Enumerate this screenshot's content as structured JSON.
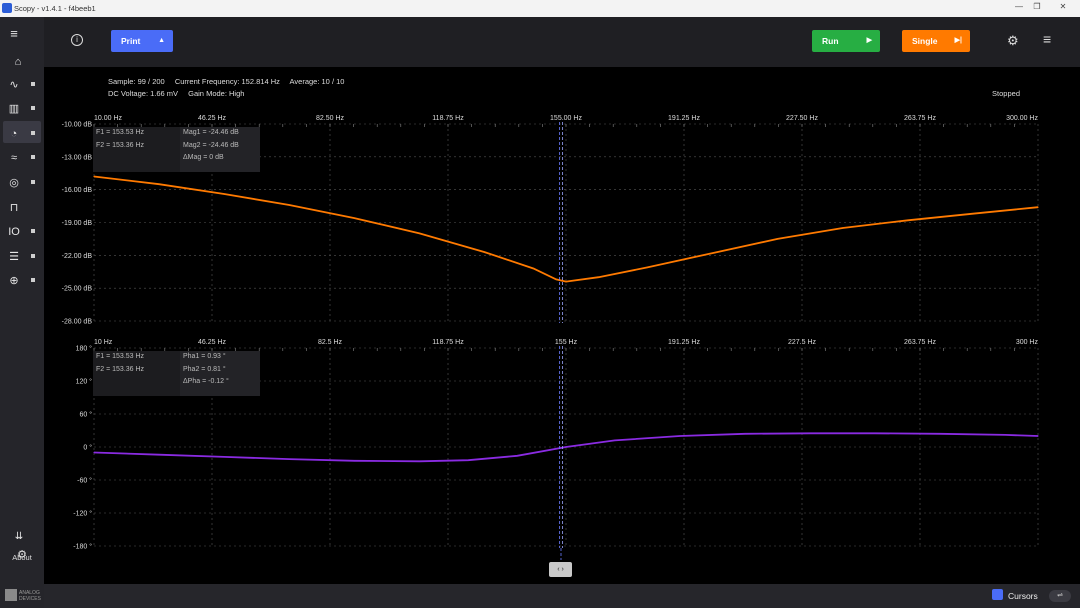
{
  "window": {
    "title": "Scopy - v1.4.1 - f4beeb1"
  },
  "toolbar": {
    "print_label": "Print",
    "run_label": "Run",
    "single_label": "Single",
    "colors": {
      "print": "#4a6cf7",
      "run": "#27ae43",
      "single": "#ff7a00"
    }
  },
  "sidebar": {
    "items": [
      {
        "icon": "home-icon"
      },
      {
        "icon": "oscilloscope-icon"
      },
      {
        "icon": "spectrum-analyzer-icon"
      },
      {
        "icon": "network-analyzer-icon"
      },
      {
        "icon": "signal-generator-icon"
      },
      {
        "icon": "voltmeter-icon"
      },
      {
        "icon": "pattern-generator-icon"
      },
      {
        "icon": "digital-io-icon"
      },
      {
        "icon": "power-supply-icon"
      },
      {
        "icon": "logic-analyzer-icon"
      }
    ],
    "about_label": "About"
  },
  "status": {
    "sample": "Sample: 99 / 200",
    "current_frequency": "Current Frequency: 152.814 Hz",
    "average": "Average: 10 / 10",
    "dc_voltage": "DC Voltage: 1.66 mV",
    "gain_mode": "Gain Mode: High",
    "state": "Stopped"
  },
  "magnitude_plot": {
    "x_ticks": [
      "10.00 Hz",
      "46.25 Hz",
      "82.50 Hz",
      "118.75 Hz",
      "155.00 Hz",
      "191.25 Hz",
      "227.50 Hz",
      "263.75 Hz",
      "300.00 Hz"
    ],
    "y_ticks": [
      "-10.00 dB",
      "-13.00 dB",
      "-16.00 dB",
      "-19.00 dB",
      "-22.00 dB",
      "-25.00 dB",
      "-28.00 dB"
    ],
    "readout": {
      "f1": "F1 =  153.53 Hz",
      "f2": "F2 =  153.36 Hz",
      "v1": "Mag1 =  -24.46 dB",
      "v2": "Mag2 =  -24.46 dB",
      "dv": "ΔMag =  0 dB"
    }
  },
  "phase_plot": {
    "x_ticks": [
      "10 Hz",
      "46.25 Hz",
      "82.5 Hz",
      "118.75 Hz",
      "155 Hz",
      "191.25 Hz",
      "227.5 Hz",
      "263.75 Hz",
      "300 Hz"
    ],
    "y_ticks": [
      "180 °",
      "120 °",
      "60 °",
      "0 °",
      "-60 °",
      "-120 °",
      "-180 °"
    ],
    "readout": {
      "f1": "F1 =  153.53 Hz",
      "f2": "F2 =  153.36 Hz",
      "v1": "Pha1 =  0.93 °",
      "v2": "Pha2 =  0.81 °",
      "dv": "ΔPha =  -0.12 °"
    }
  },
  "chart_data": [
    {
      "type": "line",
      "xlim": [
        10,
        300
      ],
      "ylim": [
        -28,
        -10
      ],
      "color": "#ff7a00",
      "cursor_x": 153.5,
      "series": [
        {
          "x": [
            10,
            30,
            50,
            70,
            90,
            110,
            130,
            145,
            152,
            155,
            165,
            180,
            200,
            220,
            240,
            260,
            280,
            300
          ],
          "y": [
            -14.8,
            -15.5,
            -16.4,
            -17.4,
            -18.6,
            -20.0,
            -21.7,
            -23.2,
            -24.2,
            -24.4,
            -24.0,
            -23.1,
            -21.8,
            -20.5,
            -19.5,
            -18.8,
            -18.2,
            -17.6
          ]
        }
      ]
    },
    {
      "type": "line",
      "xlim": [
        10,
        300
      ],
      "ylim": [
        -180,
        180
      ],
      "color": "#8a2be2",
      "cursor_x": 153.5,
      "series": [
        {
          "x": [
            10,
            30,
            50,
            70,
            90,
            110,
            125,
            140,
            155,
            170,
            190,
            210,
            230,
            250,
            270,
            290,
            300
          ],
          "y": [
            -10,
            -14,
            -18,
            -22,
            -25,
            -26,
            -24,
            -16,
            0,
            12,
            20,
            24,
            25,
            25,
            24,
            22,
            20
          ]
        }
      ]
    }
  ],
  "footer": {
    "cursors_label": "Cursors",
    "logo_text": "ANALOG DEVICES",
    "scroll_handle_label": "‹ ›"
  }
}
